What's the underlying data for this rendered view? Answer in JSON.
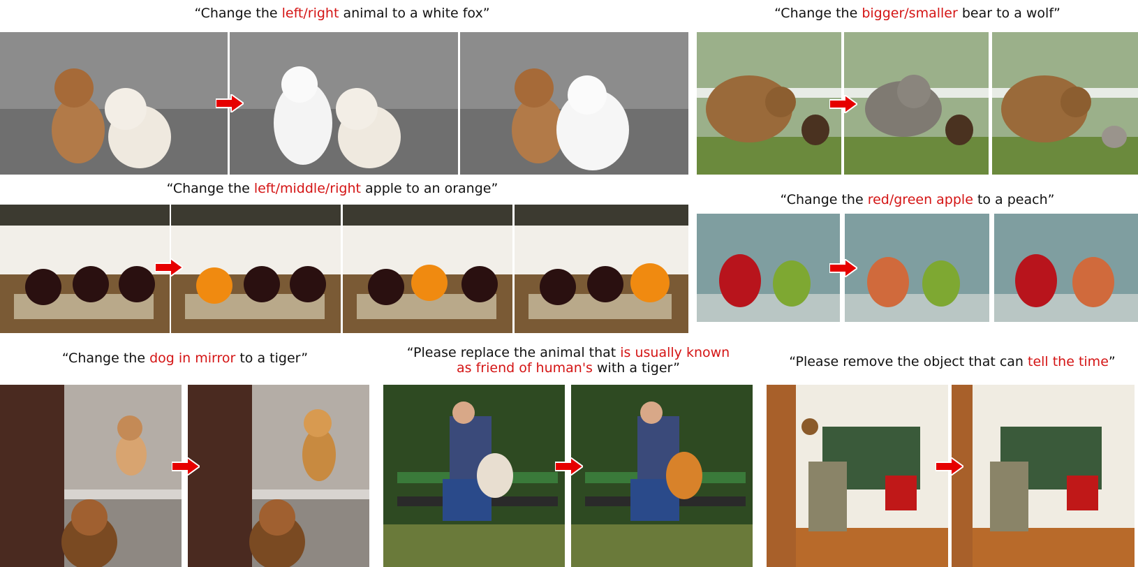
{
  "captions": {
    "fox": {
      "pre": "“Change the ",
      "hl": "left/right",
      "post": " animal to a white fox”"
    },
    "wolf": {
      "pre": "“Change the ",
      "hl": "bigger/smaller",
      "post": " bear to a wolf”"
    },
    "orange": {
      "pre": "“Change the ",
      "hl": "left/middle/right",
      "post": " apple to an orange”"
    },
    "peach": {
      "pre": "“Change the ",
      "hl": "red/green apple",
      "post": " to a peach”"
    },
    "mirror": {
      "pre": "“Change the ",
      "hl": "dog in mirror",
      "post": " to a tiger”"
    },
    "friend": {
      "pre1": "“Please replace the animal that ",
      "hl1": "is usually known",
      "hl2": "as friend of human's",
      "post2": " with a tiger”"
    },
    "clock": {
      "pre": "“Please remove the object that can ",
      "hl": "tell the time",
      "post": "”"
    }
  },
  "colors": {
    "highlight": "#d41414",
    "arrow": "#e60000"
  }
}
